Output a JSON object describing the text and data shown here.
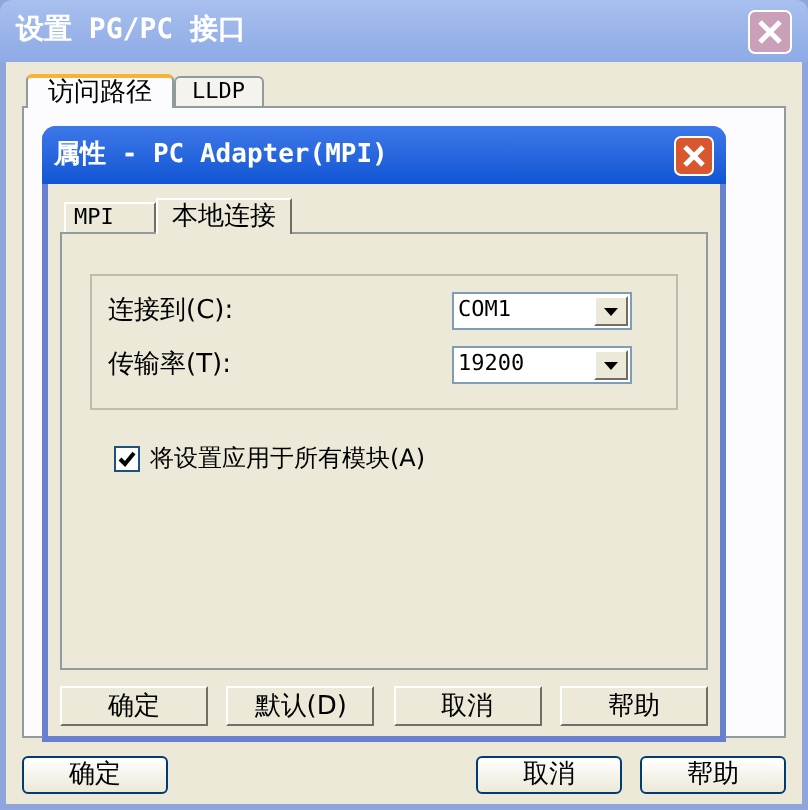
{
  "window": {
    "title": "设置 PG/PC 接口"
  },
  "tabs": [
    {
      "label": "访问路径",
      "selected": true
    },
    {
      "label": "LLDP",
      "selected": false
    }
  ],
  "buttons": [
    "确定",
    "取消",
    "帮助"
  ],
  "dialog": {
    "title": "属性 - PC Adapter(MPI)",
    "tabs": [
      {
        "label": "MPI",
        "selected": false
      },
      {
        "label": "本地连接",
        "selected": true
      }
    ],
    "fields": [
      {
        "label": "连接到(C):",
        "value": "COM1"
      },
      {
        "label": "传输率(T):",
        "value": "19200"
      }
    ],
    "checkbox": {
      "label": "将设置应用于所有模块(A)",
      "checked": true
    },
    "buttons": [
      "确定",
      "默认(D)",
      "取消",
      "帮助"
    ]
  }
}
